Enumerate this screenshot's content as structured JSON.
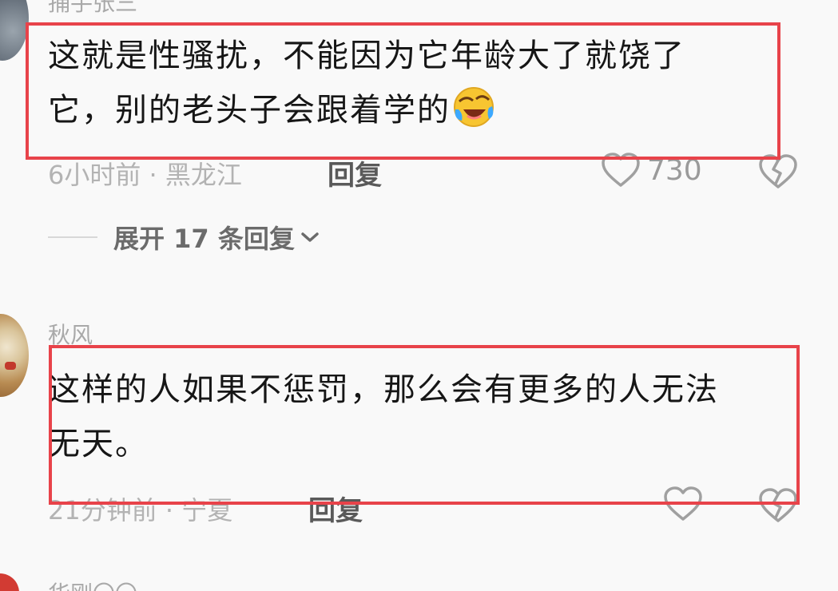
{
  "comments": [
    {
      "username": "捕手张三",
      "text_line1": "这就是性骚扰，不能因为它年龄大了就饶了",
      "text_line2": "它，别的老头子会跟着学的",
      "emoji": "laughing-crying-emoji",
      "meta": "6小时前 · 黑龙江",
      "reply_label": "回复",
      "likes": "730",
      "expand_label": "展开 17 条回复"
    },
    {
      "username": "秋风",
      "text_line1": "这样的人如果不惩罚，那么会有更多的人无法",
      "text_line2": "无天。",
      "meta": "21分钟前 · 宁夏",
      "reply_label": "回复",
      "likes": ""
    },
    {
      "username": "华刚〇〇"
    }
  ],
  "icons": {
    "like": "heart-outline-icon",
    "dislike": "broken-heart-icon",
    "expand": "chevron-down-icon"
  },
  "colors": {
    "highlight_border": "#e8434a",
    "background": "#f9f9f9",
    "text_primary": "#161616",
    "text_meta": "#b3b3b3"
  }
}
